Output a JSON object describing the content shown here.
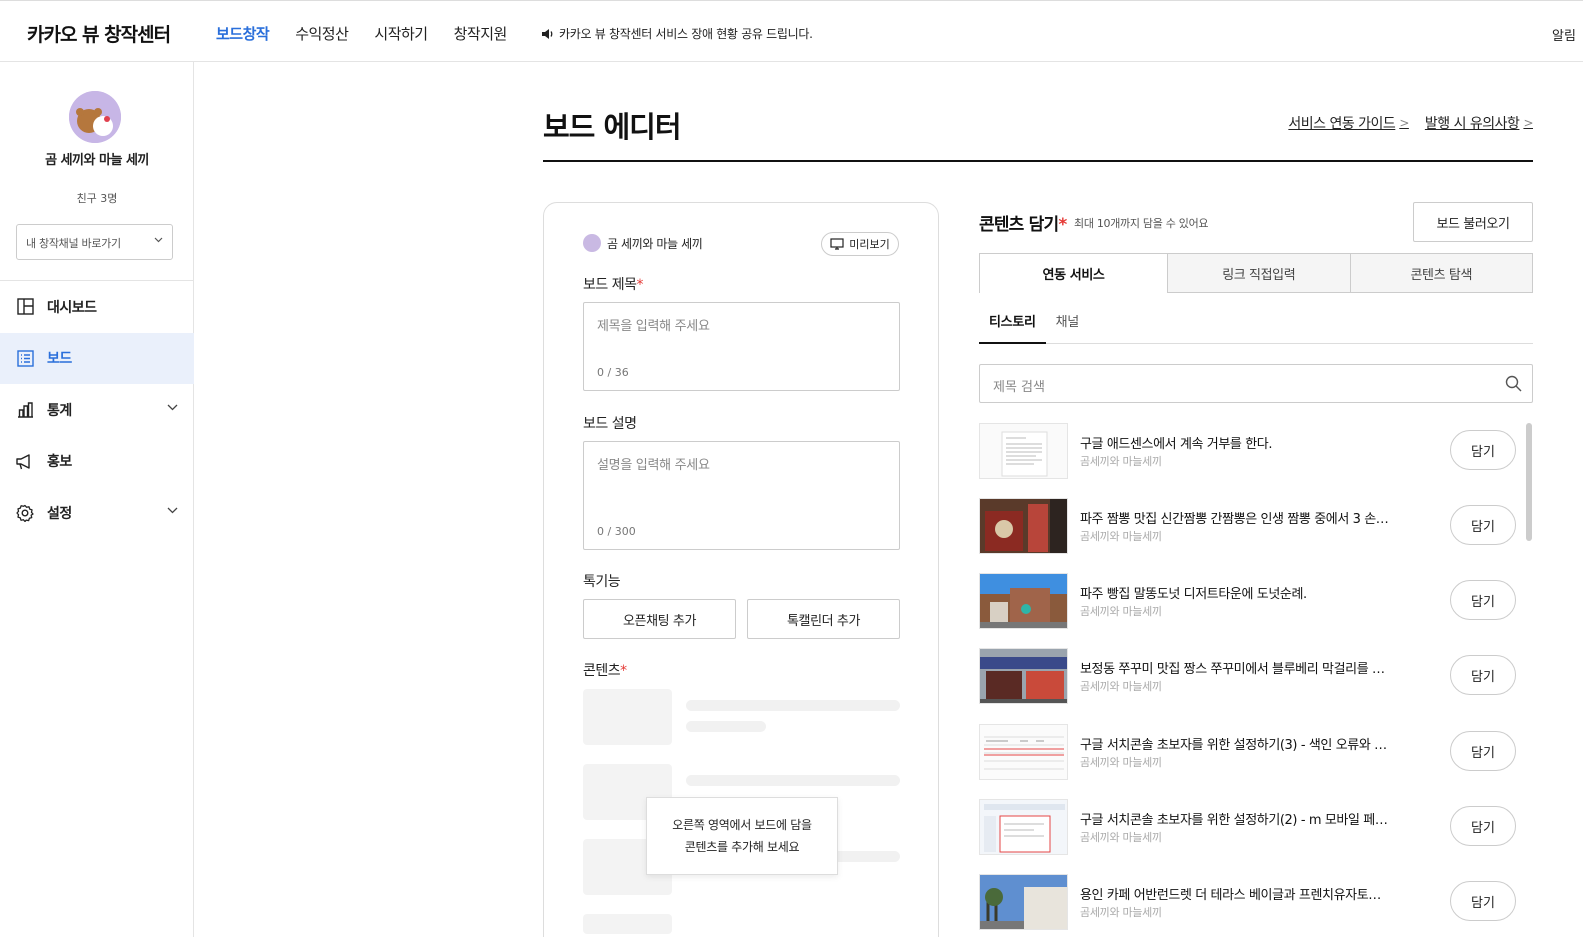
{
  "header": {
    "logo": "카카오 뷰 창작센터",
    "nav": [
      "보드창작",
      "수익정산",
      "시작하기",
      "창작지원"
    ],
    "notice": "카카오 뷰 창작센터 서비스 장애 현황 공유 드립니다.",
    "right_text": "알림"
  },
  "sidebar": {
    "profile_name": "곰 세끼와 마늘 세끼",
    "friends": "친구 3명",
    "channel_select": "내 창작채널 바로가기",
    "menu": [
      {
        "label": "대시보드",
        "icon": "dashboard-icon"
      },
      {
        "label": "보드",
        "icon": "board-list-icon"
      },
      {
        "label": "통계",
        "icon": "bar-chart-icon"
      },
      {
        "label": "홍보",
        "icon": "megaphone-icon"
      },
      {
        "label": "설정",
        "icon": "gear-icon"
      }
    ]
  },
  "main": {
    "title": "보드 에디터",
    "links": [
      "서비스 연동 가이드",
      "발행 시 유의사항"
    ]
  },
  "editor": {
    "owner": "곰 세끼와 마늘 세끼",
    "preview": "미리보기",
    "board_title_label": "보드 제목",
    "board_title_placeholder": "제목을 입력해 주세요",
    "board_title_count": "0 / 36",
    "board_desc_label": "보드 설명",
    "board_desc_placeholder": "설명을 입력해 주세요",
    "board_desc_count": "0 / 300",
    "talk_label": "톡기능",
    "open_chat": "오픈채팅 추가",
    "talk_calendar": "톡캘린더 추가",
    "contents_label": "콘텐츠",
    "tooltip_line1": "오른쪽 영역에서 보드에 담을",
    "tooltip_line2": "콘텐츠를 추가해 보세요"
  },
  "content_panel": {
    "title": "콘텐츠 담기",
    "note": "최대 10개까지 담을 수 있어요",
    "load_button": "보드 불러오기",
    "tabs": [
      "연동 서비스",
      "링크 직접입력",
      "콘텐츠 탐색"
    ],
    "subtabs": [
      "티스토리",
      "채널"
    ],
    "search_placeholder": "제목 검색",
    "add_label": "담기",
    "items": [
      {
        "title": "구글 애드센스에서 계속 거부를 한다.",
        "author": "곰세끼와 마늘세끼"
      },
      {
        "title": "파주 짬뽕 맛집 신간짬뽕 간짬뽕은 인생 짬뽕 중에서 3 손…",
        "author": "곰세끼와 마늘세끼"
      },
      {
        "title": "파주 빵집 말똥도넛 디저트타운에 도넛순례.",
        "author": "곰세끼와 마늘세끼"
      },
      {
        "title": "보정동 쭈꾸미 맛집 짱스 쭈꾸미에서 블루베리 막걸리를 …",
        "author": "곰세끼와 마늘세끼"
      },
      {
        "title": "구글 서치콘솔 초보자를 위한 설정하기(3) - 색인 오류와 …",
        "author": "곰세끼와 마늘세끼"
      },
      {
        "title": "구글 서치콘솔 초보자를 위한 설정하기(2) - m 모바일 페…",
        "author": "곰세끼와 마늘세끼"
      },
      {
        "title": "용인 카페 어반런드렛 더 테라스 베이글과 프렌치유자토…",
        "author": "곰세끼와 마늘세끼"
      }
    ]
  },
  "colors": {
    "accent": "#2a6fdb",
    "required": "#e53935",
    "active_menu_bg": "#eaf0fb"
  }
}
